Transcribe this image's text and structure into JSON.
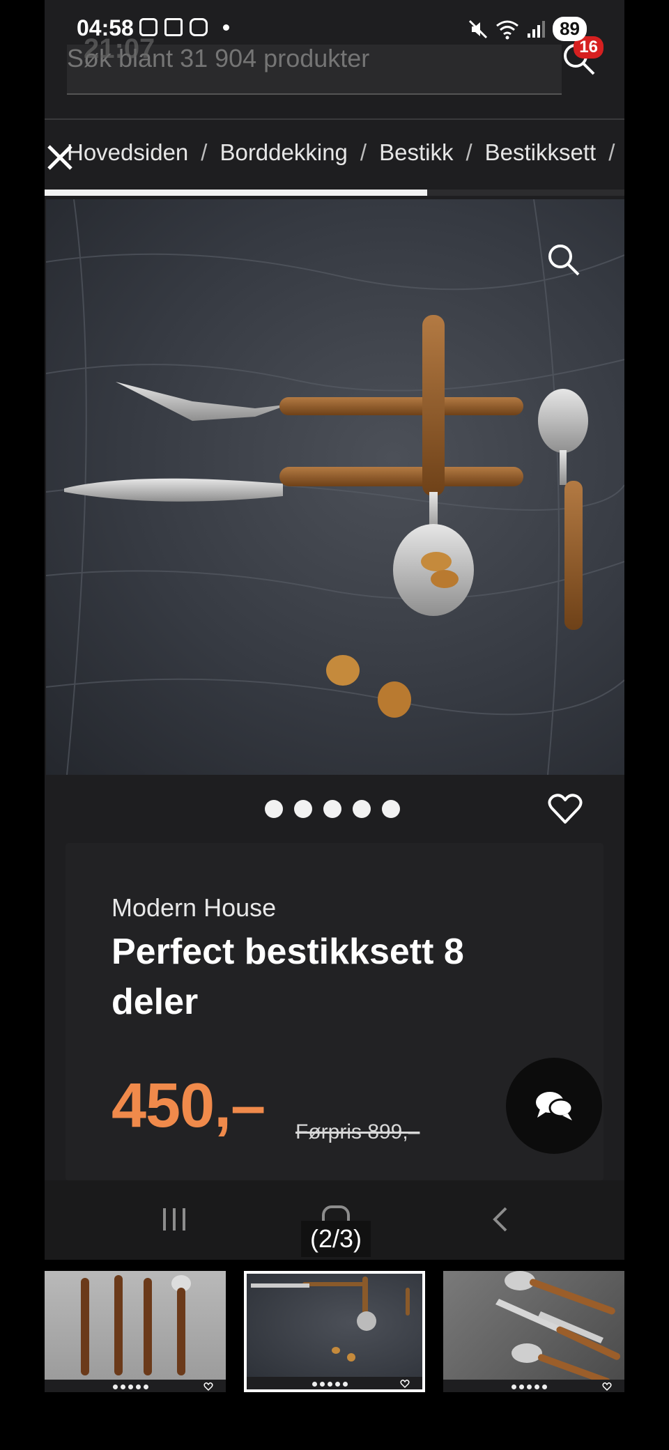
{
  "status_bar": {
    "time": "04:58",
    "battery": "89",
    "notification_icons": [
      "screenshot-icon",
      "layers-icon",
      "instagram-icon"
    ],
    "system_icons": [
      "mute-icon",
      "wifi-icon",
      "signal-icon"
    ]
  },
  "header": {
    "search_placeholder": "Søk blant 31 904 produkter",
    "ghost_time": "21:07",
    "cart_count": "16"
  },
  "breadcrumb": {
    "items": [
      "Hovedsiden",
      "Borddekking",
      "Bestikk",
      "Bestikksett"
    ],
    "separator": "/"
  },
  "gallery": {
    "progress": 0.66,
    "dot_count": 5,
    "page_indicator": "(2/3)"
  },
  "product": {
    "brand": "Modern House",
    "title": "Perfect bestikksett 8 deler",
    "price": "450,–",
    "old_price": "Førpris 899,–"
  },
  "colors": {
    "accent_price": "#f08a4b",
    "background": "#1e1e20"
  },
  "thumbnails": [
    {
      "name": "thumb-1",
      "selected": false
    },
    {
      "name": "thumb-2",
      "selected": true
    },
    {
      "name": "thumb-3",
      "selected": false
    }
  ]
}
